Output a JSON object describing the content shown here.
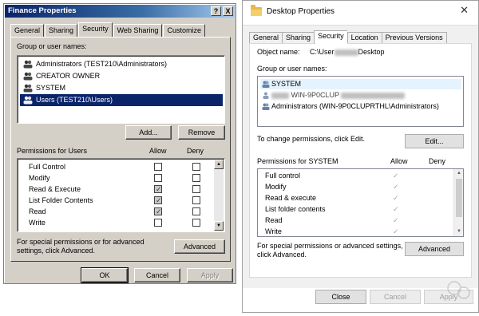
{
  "left_dialog": {
    "title": "Finance Properties",
    "title_buttons": [
      "?",
      "X"
    ],
    "tabs": [
      "General",
      "Sharing",
      "Security",
      "Web Sharing",
      "Customize"
    ],
    "active_tab": "Security",
    "group_label": "Group or user names:",
    "users": [
      "Administrators (TEST210\\Administrators)",
      "CREATOR OWNER",
      "SYSTEM",
      "Users (TEST210\\Users)"
    ],
    "selected_user": "Users (TEST210\\Users)",
    "add_button": "Add...",
    "remove_button": "Remove",
    "permissions_label": "Permissions for Users",
    "allow_header": "Allow",
    "deny_header": "Deny",
    "permissions": [
      {
        "name": "Full Control",
        "allow": false,
        "deny": false
      },
      {
        "name": "Modify",
        "allow": false,
        "deny": false
      },
      {
        "name": "Read & Execute",
        "allow": true,
        "deny": false
      },
      {
        "name": "List Folder Contents",
        "allow": true,
        "deny": false
      },
      {
        "name": "Read",
        "allow": true,
        "deny": false
      },
      {
        "name": "Write",
        "allow": false,
        "deny": false
      }
    ],
    "advanced_text": "For special permissions or for advanced settings, click Advanced.",
    "advanced_button": "Advanced",
    "ok_button": "OK",
    "cancel_button": "Cancel",
    "apply_button": "Apply"
  },
  "right_dialog": {
    "title": "Desktop Properties",
    "close_glyph": "✕",
    "tabs": [
      "General",
      "Sharing",
      "Security",
      "Location",
      "Previous Versions"
    ],
    "active_tab": "Security",
    "object_name_label": "Object name:",
    "object_name_prefix": "C:\\User",
    "object_name_suffix": "Desktop",
    "group_label": "Group or user names:",
    "users": [
      {
        "text": "SYSTEM",
        "partially_blurred": false
      },
      {
        "text": "WIN-9P0CLUP",
        "partially_blurred": true
      },
      {
        "text": "Administrators (WIN-9P0CLUPRTHL\\Administrators)",
        "partially_blurred": false
      }
    ],
    "change_text": "To change permissions, click Edit.",
    "edit_button": "Edit...",
    "permissions_label": "Permissions for SYSTEM",
    "allow_header": "Allow",
    "deny_header": "Deny",
    "permissions": [
      {
        "name": "Full control",
        "allow": true
      },
      {
        "name": "Modify",
        "allow": true
      },
      {
        "name": "Read & execute",
        "allow": true
      },
      {
        "name": "List folder contents",
        "allow": true
      },
      {
        "name": "Read",
        "allow": true
      },
      {
        "name": "Write",
        "allow": true
      }
    ],
    "advanced_text_1": "For special permissions or advanced settings,",
    "advanced_text_2": "click Advanced.",
    "advanced_button": "Advanced",
    "close_button": "Close",
    "cancel_button": "Cancel",
    "apply_button": "Apply"
  },
  "colors": {
    "classic_face": "#d4d0c8",
    "classic_title": "#0a246a",
    "selection": "#0a246a",
    "modern_selection": "#e5f3ff",
    "folder": "#e8b84a"
  }
}
